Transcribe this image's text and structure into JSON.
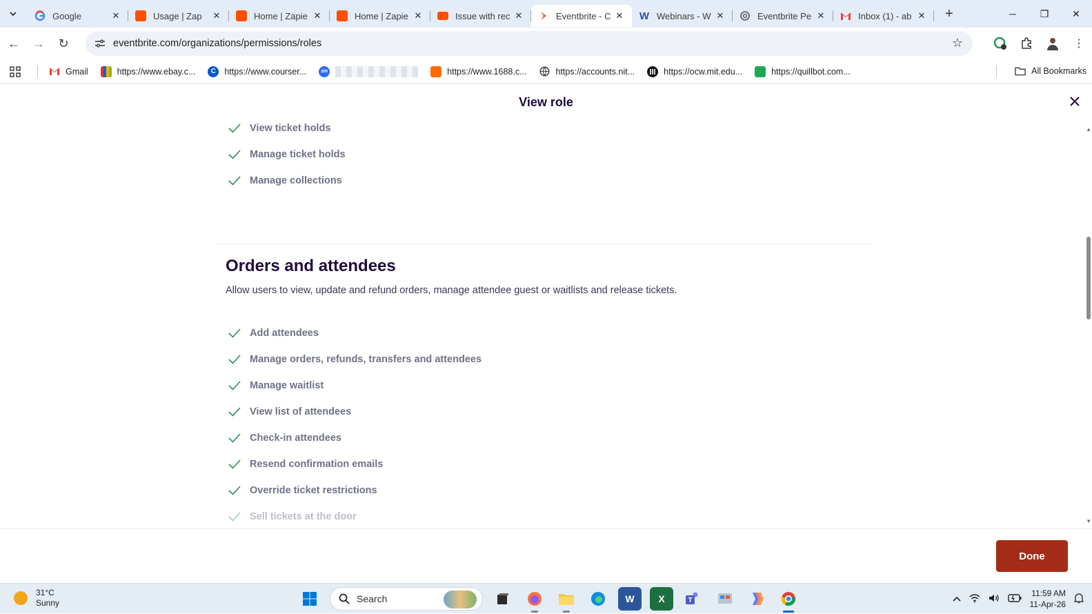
{
  "browser": {
    "tabs": [
      {
        "title": "Google",
        "favicon": "google-icon",
        "color": "#ffffff",
        "active": false
      },
      {
        "title": "Usage | Zap",
        "favicon": "zapier-icon",
        "color": "#ff4f00",
        "active": false
      },
      {
        "title": "Home | Zapie",
        "favicon": "zapier-icon",
        "color": "#ff4f00",
        "active": false
      },
      {
        "title": "Home | Zapie",
        "favicon": "zapier-icon",
        "color": "#ff4f00",
        "active": false
      },
      {
        "title": "Issue with rec",
        "favicon": "zapier-community-icon",
        "color": "#ff4f00",
        "active": false
      },
      {
        "title": "Eventbrite - C",
        "favicon": "eventbrite-icon",
        "color": "#f05537",
        "active": true
      },
      {
        "title": "Webinars - W",
        "favicon": "webinars-w-icon",
        "color": "#ffffff",
        "active": false
      },
      {
        "title": "Eventbrite Pe",
        "favicon": "openai-icon",
        "color": "#ffffff",
        "active": false
      },
      {
        "title": "Inbox (1) - ab",
        "favicon": "gmail-icon",
        "color": "#ffffff",
        "active": false
      }
    ],
    "url": "eventbrite.com/organizations/permissions/roles",
    "bookmarks": [
      {
        "label": "Gmail",
        "icon": "gmail-icon"
      },
      {
        "label": "https://www.ebay.c...",
        "icon": "ebay-icon"
      },
      {
        "label": "https://www.courser...",
        "icon": "coursera-icon"
      },
      {
        "label": "",
        "icon": "zoom-icon"
      },
      {
        "label": "https://www.1688.c...",
        "icon": "1688-icon"
      },
      {
        "label": "https://accounts.nit...",
        "icon": "globe-icon"
      },
      {
        "label": "https://ocw.mit.edu...",
        "icon": "mit-icon"
      },
      {
        "label": "https://quillbot.com...",
        "icon": "quillbot-icon"
      }
    ],
    "all_bookmarks": "All Bookmarks"
  },
  "modal": {
    "title": "View role",
    "permissions_top": [
      "View ticket holds",
      "Manage ticket holds",
      "Manage collections"
    ],
    "section": {
      "title": "Orders and attendees",
      "description": "Allow users to view, update and refund orders, manage attendee guest or waitlists and release tickets.",
      "permissions": [
        "Add attendees",
        "Manage orders, refunds, transfers and attendees",
        "Manage waitlist",
        "View list of attendees",
        "Check-in attendees",
        "Resend confirmation emails",
        "Override ticket restrictions",
        "Sell tickets at the door"
      ]
    },
    "done_label": "Done",
    "accent_color": "#a42c18",
    "check_color": "#2e8b57"
  },
  "taskbar": {
    "temperature": "31°C",
    "condition": "Sunny",
    "search_label": "Search",
    "time": "11:59 AM",
    "date": "11-Apr-26"
  }
}
